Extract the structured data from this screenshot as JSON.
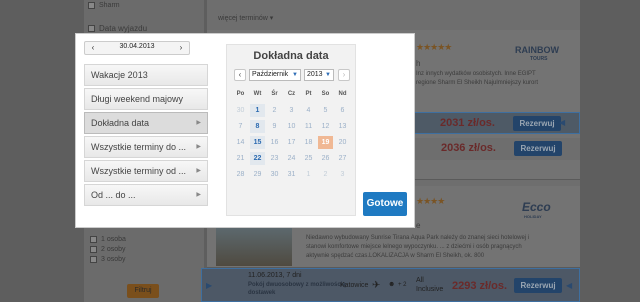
{
  "background": {
    "sidebar": {
      "sharm": "Sharm",
      "date_section": "Data wyjazdu",
      "persons": [
        "1 osoba",
        "2 osoby",
        "3 osoby"
      ],
      "filter_button": "Filtruj"
    },
    "more_terms": "więcej terminów ▾",
    "card1": {
      "logo": "RAINBOW",
      "logo_sub": "TOURS",
      "stars": "★★★★★",
      "line_h": "h",
      "text": "Inz innych wydatków osobistych. Inne EGIPT\nregione Sharm El Sheikh Najulmniejszy kurort",
      "price1": "2031 zł/os.",
      "price2": "2036 zł/os.",
      "button": "Rezerwuj"
    },
    "card2": {
      "logo": "Ecco",
      "logo_sub": "HOLIDAY",
      "stars": "★★★★",
      "line_e": "e",
      "text": "Niedawno wybudowany Sunrise Tirana Aqua Park należy do znanej sieci hotelowej i\nstanowi komfortowe miejsce lelnego wypoczynku. ... z dziećmi i osób pragnących\naktywnie spędzać czas.LOKALIZACJA w Sharm El Sheikh, ok. 800"
    },
    "bottom_offer": {
      "date": "11.06.2013, 7 dni",
      "room": "Pokój dwuosobowy z możliwością\ndostawek",
      "city": "Katowice",
      "plus": "+ 2",
      "board": "All\nInclusive",
      "price": "2293 zł/os.",
      "button": "Rezerwuj"
    }
  },
  "modal": {
    "date_value": "30.04.2013",
    "nav_prev_icon": "chevron-left-icon",
    "nav_next_icon": "chevron-right-icon",
    "quick_options": [
      "Wakacje 2013",
      "Długi weekend majowy"
    ],
    "menu_items": [
      "Dokładna data",
      "Wszystkie terminy do ...",
      "Wszystkie terminy od ...",
      "Od ... do ..."
    ],
    "calendar": {
      "title": "Dokładna data",
      "month": "Październik",
      "year": "2013",
      "dow": [
        "Po",
        "Wt",
        "Śr",
        "Cz",
        "Pt",
        "So",
        "Nd"
      ],
      "rows": [
        [
          "30",
          "1",
          "2",
          "3",
          "4",
          "5",
          "6"
        ],
        [
          "7",
          "8",
          "9",
          "10",
          "11",
          "12",
          "13"
        ],
        [
          "14",
          "15",
          "16",
          "17",
          "18",
          "19",
          "20"
        ],
        [
          "21",
          "22",
          "23",
          "24",
          "25",
          "26",
          "27"
        ],
        [
          "28",
          "29",
          "30",
          "31",
          "1",
          "2",
          "3"
        ]
      ]
    },
    "done_button": "Gotowe"
  }
}
